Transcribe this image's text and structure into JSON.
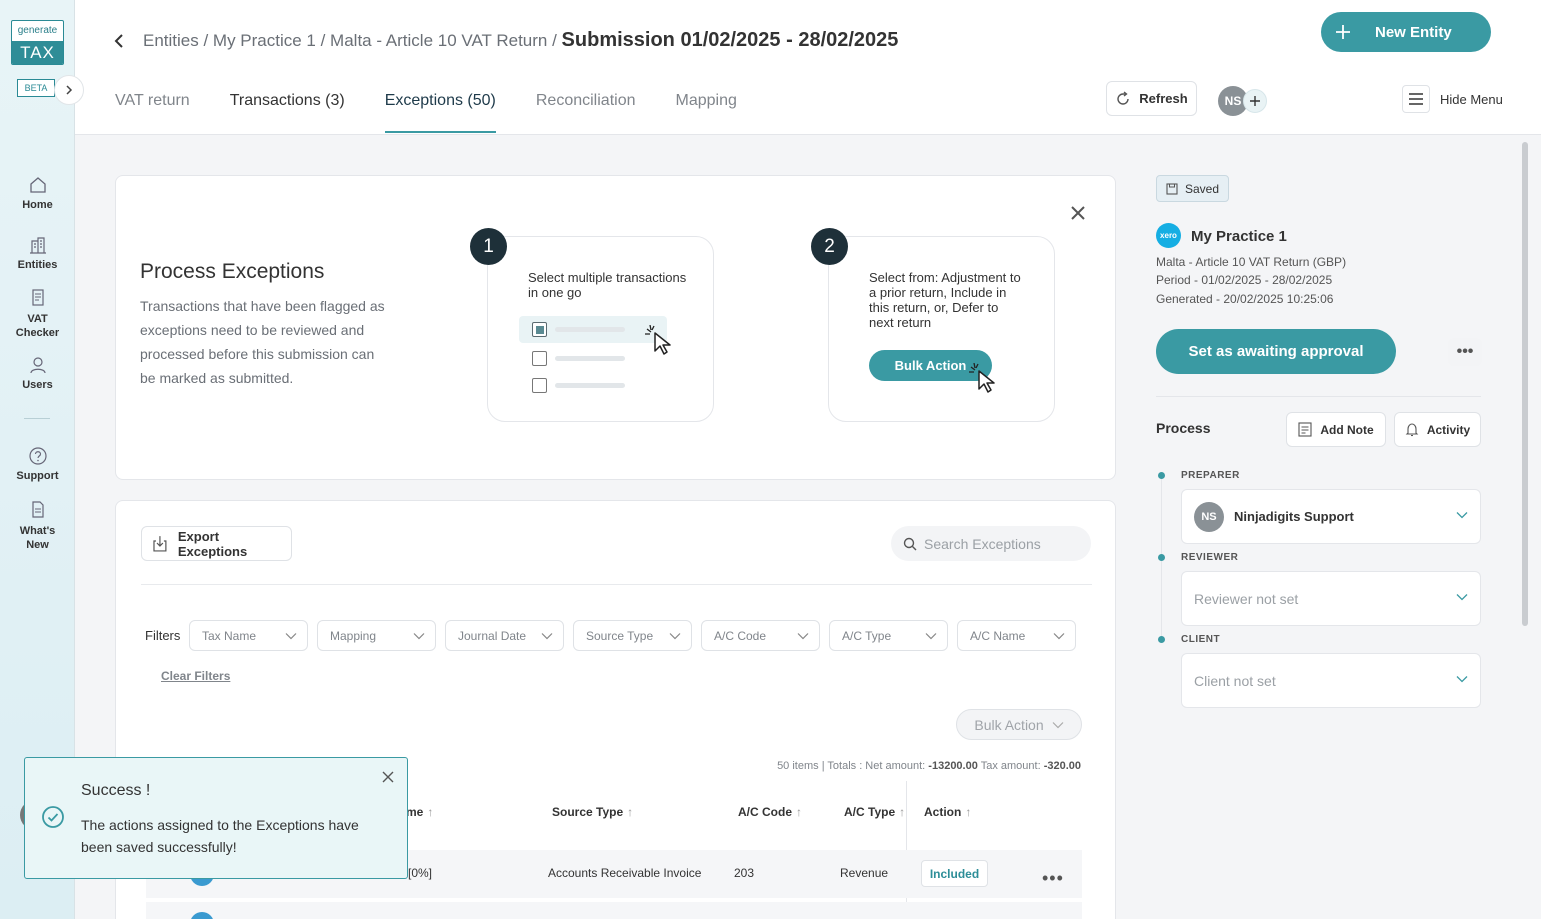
{
  "app": {
    "logo_top": "generate",
    "logo_bottom": "TAX",
    "beta_label": "BETA"
  },
  "sidebar": {
    "items": [
      {
        "label": "Home",
        "icon": "home-icon"
      },
      {
        "label": "Entities",
        "icon": "building-icon"
      },
      {
        "label": "VAT Checker",
        "icon": "document-icon"
      },
      {
        "label": "Users",
        "icon": "user-icon"
      },
      {
        "label": "Support",
        "icon": "question-icon"
      },
      {
        "label": "What's New",
        "icon": "news-icon"
      }
    ]
  },
  "header": {
    "breadcrumb_path": "Entities / My Practice 1 / Malta - Article 10 VAT Return /",
    "breadcrumb_current": "Submission 01/02/2025 - 28/02/2025",
    "new_entity_label": "New Entity",
    "refresh_label": "Refresh",
    "avatar_initials": "NS",
    "hide_menu_label": "Hide Menu",
    "tabs": [
      {
        "label": "VAT return"
      },
      {
        "label": "Transactions (3)"
      },
      {
        "label": "Exceptions (50)"
      },
      {
        "label": "Reconciliation"
      },
      {
        "label": "Mapping"
      }
    ]
  },
  "intro": {
    "title": "Process Exceptions",
    "description": "Transactions that have been flagged as exceptions need to be reviewed and processed before this submission can be marked as submitted.",
    "step1_number": "1",
    "step1_text": "Select multiple transactions in one go",
    "step2_number": "2",
    "step2_text": "Select from: Adjustment to a prior return, Include in this return, or, Defer to next return",
    "step2_button": "Bulk Action"
  },
  "table": {
    "export_label": "Export Exceptions",
    "search_placeholder": "Search Exceptions",
    "filters_label": "Filters",
    "filters": [
      "Tax Name",
      "Mapping",
      "Journal Date",
      "Source Type",
      "A/C Code",
      "A/C Type",
      "A/C Name"
    ],
    "clear_filters_label": "Clear Filters",
    "bulk_action_label": "Bulk Action",
    "totals_prefix": "50 items | Totals : Net amount: ",
    "net_amount": "-13200.00",
    "tax_amount_label": " Tax amount: ",
    "tax_amount": "-320.00",
    "columns": {
      "name": "me",
      "source_type": "Source Type",
      "ac_code": "A/C Code",
      "ac_type": "A/C Type",
      "action": "Action"
    },
    "rows": [
      {
        "name": "[0%]",
        "source_type": "Accounts Receivable Invoice",
        "ac_code": "203",
        "ac_type": "Revenue",
        "action": "Included"
      }
    ]
  },
  "right_panel": {
    "saved_label": "Saved",
    "org_logo": "xero",
    "org_name": "My Practice 1",
    "return_type": "Malta - Article 10 VAT Return (GBP)",
    "period": "Period - 01/02/2025 - 28/02/2025",
    "generated": "Generated - 20/02/2025 10:25:06",
    "approve_label": "Set as awaiting approval",
    "process_title": "Process",
    "add_note_label": "Add Note",
    "activity_label": "Activity",
    "preparer_label": "PREPARER",
    "preparer_initials": "NS",
    "preparer_name": "Ninjadigits Support",
    "reviewer_label": "REVIEWER",
    "reviewer_value": "Reviewer not set",
    "client_label": "CLIENT",
    "client_value": "Client not set"
  },
  "toast": {
    "title": "Success !",
    "message": "The actions assigned to the Exceptions have been saved successfully!"
  },
  "colors": {
    "accent": "#3a9aa3",
    "dark": "#1e3039",
    "xero": "#15aee3"
  }
}
